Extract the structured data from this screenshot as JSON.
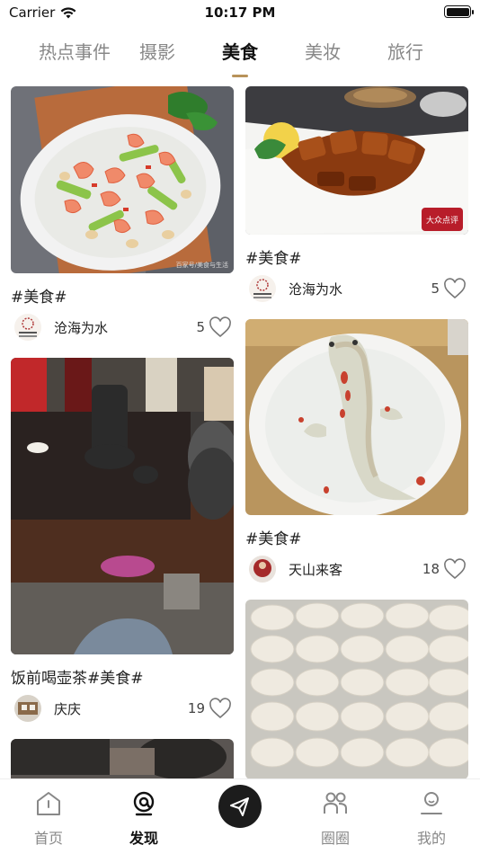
{
  "status_bar": {
    "carrier": "Carrier",
    "time": "10:17 PM"
  },
  "tabs": [
    {
      "label": "热点事件",
      "active": false
    },
    {
      "label": "摄影",
      "active": false
    },
    {
      "label": "美食",
      "active": true
    },
    {
      "label": "美妆",
      "active": false
    },
    {
      "label": "旅行",
      "active": false
    }
  ],
  "feed": {
    "left": [
      {
        "title": "#美食#",
        "author": "沧海为水",
        "likes": "5",
        "image": "shrimp-celery-dish",
        "watermark": "百家号/美食与生活"
      },
      {
        "title": "饭前喝壶茶#美食#",
        "author": "庆庆",
        "likes": "19",
        "image": "tea-table"
      },
      {
        "title": "",
        "author": "",
        "likes": "",
        "image": "partial-kitchen-photo"
      }
    ],
    "right": [
      {
        "title": "#美食#",
        "author": "沧海为水",
        "likes": "5",
        "image": "roast-duck-dish",
        "badge": "大众点评"
      },
      {
        "title": "#美食#",
        "author": "天山来客",
        "likes": "18",
        "image": "koi-fish-noodle-dish"
      },
      {
        "title": "",
        "author": "",
        "likes": "",
        "image": "dumplings"
      }
    ]
  },
  "tabbar": {
    "home": "首页",
    "discover": "发现",
    "post": "send-icon",
    "circle": "圈圈",
    "mine": "我的"
  },
  "colors": {
    "accent": "#b8925a",
    "post_button": "#1c1c1c"
  }
}
